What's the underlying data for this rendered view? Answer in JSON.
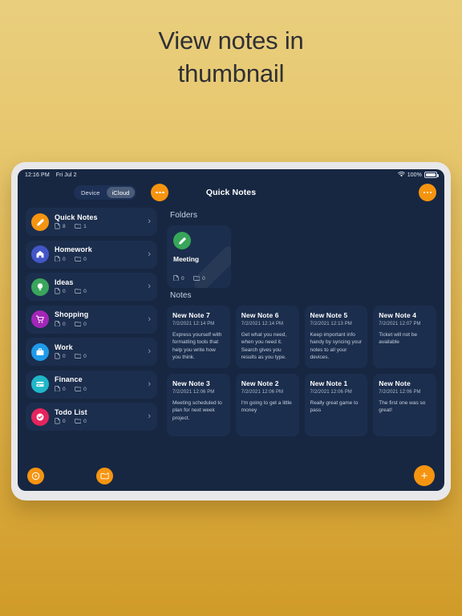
{
  "headline": "View notes in\nthumbnail",
  "colors": {
    "accent": "#f59410",
    "screen_bg": "#172742",
    "card_bg": "#1c2e4d",
    "bezel": "#e8e8ea",
    "page_top": "#e9ce7e",
    "page_bottom": "#d09b28"
  },
  "statusbar": {
    "time": "12:16 PM",
    "date": "Fri Jul 2",
    "wifi_icon": "wifi-icon",
    "battery_percent": "100%",
    "battery_icon": "battery-icon"
  },
  "topbar": {
    "segments": [
      {
        "label": "Device",
        "selected": false
      },
      {
        "label": "iCloud",
        "selected": true
      }
    ],
    "title": "Quick Notes",
    "left_more_icon": "more-horizontal-icon",
    "right_more_icon": "more-horizontal-icon"
  },
  "sidebar": {
    "items": [
      {
        "label": "Quick Notes",
        "notes": "8",
        "folders": "1",
        "icon": "pencil-icon",
        "color": "#f59410"
      },
      {
        "label": "Homework",
        "notes": "0",
        "folders": "0",
        "icon": "home-icon",
        "color": "#4356c8"
      },
      {
        "label": "Ideas",
        "notes": "0",
        "folders": "0",
        "icon": "lightbulb-icon",
        "color": "#3aa55c"
      },
      {
        "label": "Shopping",
        "notes": "0",
        "folders": "0",
        "icon": "cart-icon",
        "color": "#a326b8"
      },
      {
        "label": "Work",
        "notes": "0",
        "folders": "0",
        "icon": "briefcase-icon",
        "color": "#1e9bea"
      },
      {
        "label": "Finance",
        "notes": "0",
        "folders": "0",
        "icon": "card-icon",
        "color": "#1fb7c9"
      },
      {
        "label": "Todo List",
        "notes": "0",
        "folders": "0",
        "icon": "check-icon",
        "color": "#e5245e"
      }
    ],
    "chevron_icon": "chevron-right-icon",
    "note_count_icon": "note-icon",
    "folder_count_icon": "folder-icon"
  },
  "content": {
    "folders_heading": "Folders",
    "notes_heading": "Notes",
    "folders": [
      {
        "name": "Meeting",
        "notes": "0",
        "folders": "0",
        "icon": "pencil-icon",
        "color": "#37a65a"
      }
    ],
    "notes": [
      {
        "title": "New Note 7",
        "date": "7/2/2021 12:14 PM",
        "body": "Express yourself with formatting tools that help you write how you think."
      },
      {
        "title": "New Note 6",
        "date": "7/2/2021 12:14 PM",
        "body": "Get what you need, when you need it. Search gives you results as you type."
      },
      {
        "title": "New Note 5",
        "date": "7/2/2021 12:13 PM",
        "body": "Keep important info handy by syncing your notes to all your devices."
      },
      {
        "title": "New Note 4",
        "date": "7/2/2021 12:07 PM",
        "body": "Ticket will not be available"
      },
      {
        "title": "New Note 3",
        "date": "7/2/2021 12:06 PM",
        "body": "Meeting scheduled to plan for next week project."
      },
      {
        "title": "New Note 2",
        "date": "7/2/2021 12:06 PM",
        "body": "I'm going to get a little money"
      },
      {
        "title": "New Note 1",
        "date": "7/2/2021 12:06 PM",
        "body": "Really great game to pass"
      },
      {
        "title": "New Note",
        "date": "7/2/2021 12:06 PM",
        "body": "The first one was so great!"
      }
    ]
  },
  "bottombar": {
    "recent_icon": "clock-play-icon",
    "new_folder_icon": "folder-plus-icon",
    "add_label": "+"
  }
}
